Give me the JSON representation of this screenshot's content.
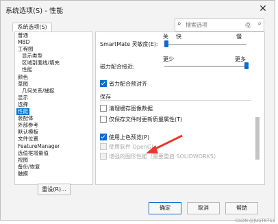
{
  "window": {
    "title": "系统选项(S) - 性能",
    "close_icon": "close-icon"
  },
  "tab": {
    "label": "系统选项(S)"
  },
  "search": {
    "placeholder": "搜索选项",
    "scope": "Ⓠ"
  },
  "sidebar": {
    "items": [
      {
        "label": "普通",
        "sub": false
      },
      {
        "label": "MBD",
        "sub": false
      },
      {
        "label": "工程图",
        "sub": false
      },
      {
        "label": "显示类型",
        "sub": true
      },
      {
        "label": "区域剖面线/填充",
        "sub": true
      },
      {
        "label": "性能",
        "sub": true
      },
      {
        "label": "颜色",
        "sub": false
      },
      {
        "label": "草图",
        "sub": false
      },
      {
        "label": "几何关系/捕捉",
        "sub": true
      },
      {
        "label": "显示",
        "sub": false
      },
      {
        "label": "选择",
        "sub": false
      },
      {
        "label": "性能",
        "sub": false,
        "selected": true
      },
      {
        "label": "装配体",
        "sub": false
      },
      {
        "label": "外部参考",
        "sub": false
      },
      {
        "label": "默认模板",
        "sub": false
      },
      {
        "label": "文件位置",
        "sub": false
      },
      {
        "label": "FeatureManager",
        "sub": false
      },
      {
        "label": "选值框增量值",
        "sub": false
      },
      {
        "label": "视图",
        "sub": false
      },
      {
        "label": "备份/恢复",
        "sub": false
      },
      {
        "label": "触摸",
        "sub": false
      }
    ],
    "reset_label": "重设(R)..."
  },
  "settings": {
    "smartmate_label": "SmartMate 灵敏度(E):",
    "smartmate_min": "关",
    "smartmate_mid": "快",
    "smartmate_max": "慢",
    "smartmate_level": 0.0,
    "mate_label": "磁力配合接近:",
    "mate_min": "更少",
    "mate_max": "更多",
    "mate_level": 1.0,
    "save_quick": "省力配合预对齐",
    "section_save": "保存",
    "clear_cache": "清理缓存图像数据",
    "save_only": "仅保存文件时更新质量属性(T)",
    "upper_color": "使用上色预览(P)",
    "opengl": "使用软件 OpenGL",
    "enhanced": "增强的图形性能（需要重启 SOLIDWORKS）"
  },
  "states": {
    "save_quick": true,
    "clear_cache": false,
    "save_only": false,
    "upper_color": true,
    "opengl": false,
    "enhanced": false
  },
  "buttons": {
    "ok": "确定",
    "cancel": "取消",
    "help": "帮助"
  },
  "watermark": "CSDN @JUSTK711"
}
